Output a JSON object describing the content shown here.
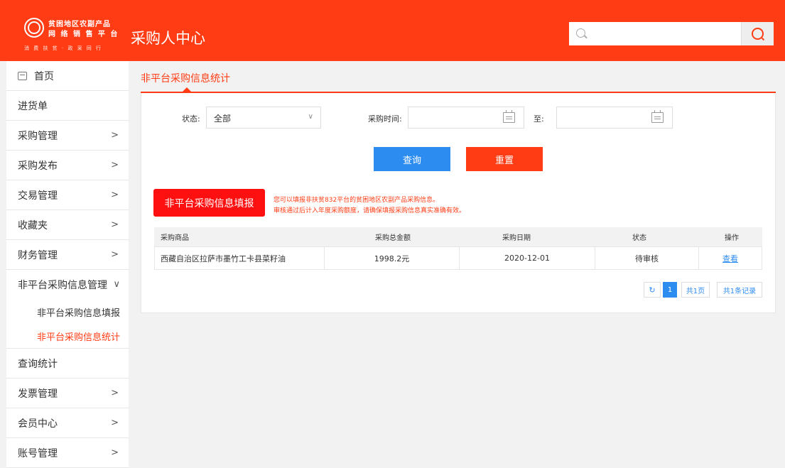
{
  "header": {
    "logo_line1": "贫困地区农副产品",
    "logo_line2": "网 络 销 售 平 台",
    "logo_slogan": "消 费 扶 贫 · 政 采 同 行",
    "title": "采购人中心",
    "search": {
      "value": "",
      "placeholder": ""
    }
  },
  "sidebar": {
    "items": [
      {
        "label": "首页"
      },
      {
        "label": "进货单"
      },
      {
        "label": "采购管理",
        "chevron": ">"
      },
      {
        "label": "采购发布",
        "chevron": ">"
      },
      {
        "label": "交易管理",
        "chevron": ">"
      },
      {
        "label": "收藏夹",
        "chevron": ">"
      },
      {
        "label": "财务管理",
        "chevron": ">"
      },
      {
        "label": "非平台采购信息管理",
        "chevron": "∨"
      },
      {
        "label": "查询统计"
      },
      {
        "label": "发票管理",
        "chevron": ">"
      },
      {
        "label": "会员中心",
        "chevron": ">"
      },
      {
        "label": "账号管理",
        "chevron": ">"
      }
    ],
    "sub_items": [
      {
        "label": "非平台采购信息填报"
      },
      {
        "label": "非平台采购信息统计"
      }
    ]
  },
  "main": {
    "title": "非平台采购信息统计",
    "filters": {
      "status_label": "状态:",
      "status_value": "全部",
      "status_chevron": "∨",
      "time_label": "采购时间:",
      "to_label": "至:",
      "start_date": "",
      "end_date": ""
    },
    "buttons": {
      "query": "查询",
      "reset": "重置"
    },
    "fill_button": "非平台采购信息填报",
    "notice_line1": "您可以填报非扶贫832平台的贫困地区农副产品采购信息。",
    "notice_line2": "审核通过后计入年度采购额度，请确保填报采购信息真实准确有效。",
    "table": {
      "headers": [
        "采购商品",
        "采购总金额",
        "采购日期",
        "状态",
        "操作"
      ],
      "rows": [
        [
          "西藏自治区拉萨市墨竹工卡县菜籽油",
          "1998.2元",
          "2020-12-01",
          "待审核",
          "查看"
        ]
      ]
    },
    "pagination": {
      "refresh_icon": "↻",
      "current_page": "1",
      "total_pages": "共1页",
      "total_records": "共1条记录"
    }
  },
  "colors": {
    "brand": "#ff3c14",
    "primary": "#2d8cf0"
  }
}
